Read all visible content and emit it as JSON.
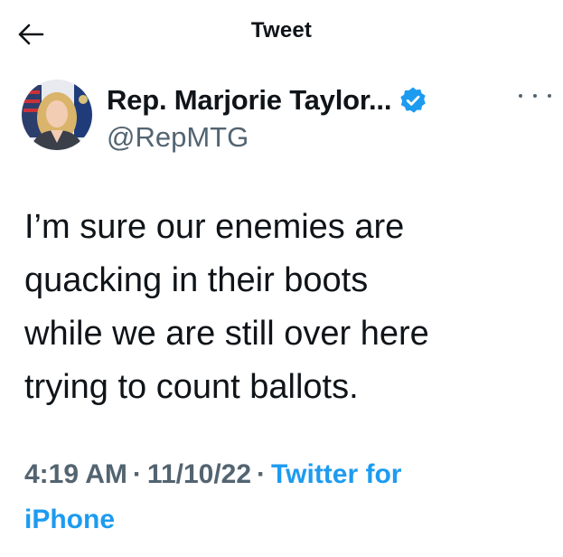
{
  "header": {
    "back_icon": "arrow-left-icon",
    "title": "Tweet"
  },
  "author": {
    "avatar_icon": "profile-photo",
    "name": "Rep. Marjorie Taylor...",
    "verified_icon": "verified-badge-icon",
    "handle": "@RepMTG",
    "more_icon": "more-options-icon"
  },
  "tweet": {
    "lines": [
      "I’m sure our enemies are",
      "quacking in their boots",
      "while we are still over here",
      "trying to count ballots."
    ]
  },
  "meta": {
    "time": "4:19 AM",
    "separator": "·",
    "date": "11/10/22",
    "source_line1": "Twitter for",
    "source_line2": "iPhone"
  },
  "colors": {
    "text": "#0f1419",
    "secondary": "#536471",
    "accent": "#1d9bf0",
    "background": "#ffffff"
  }
}
